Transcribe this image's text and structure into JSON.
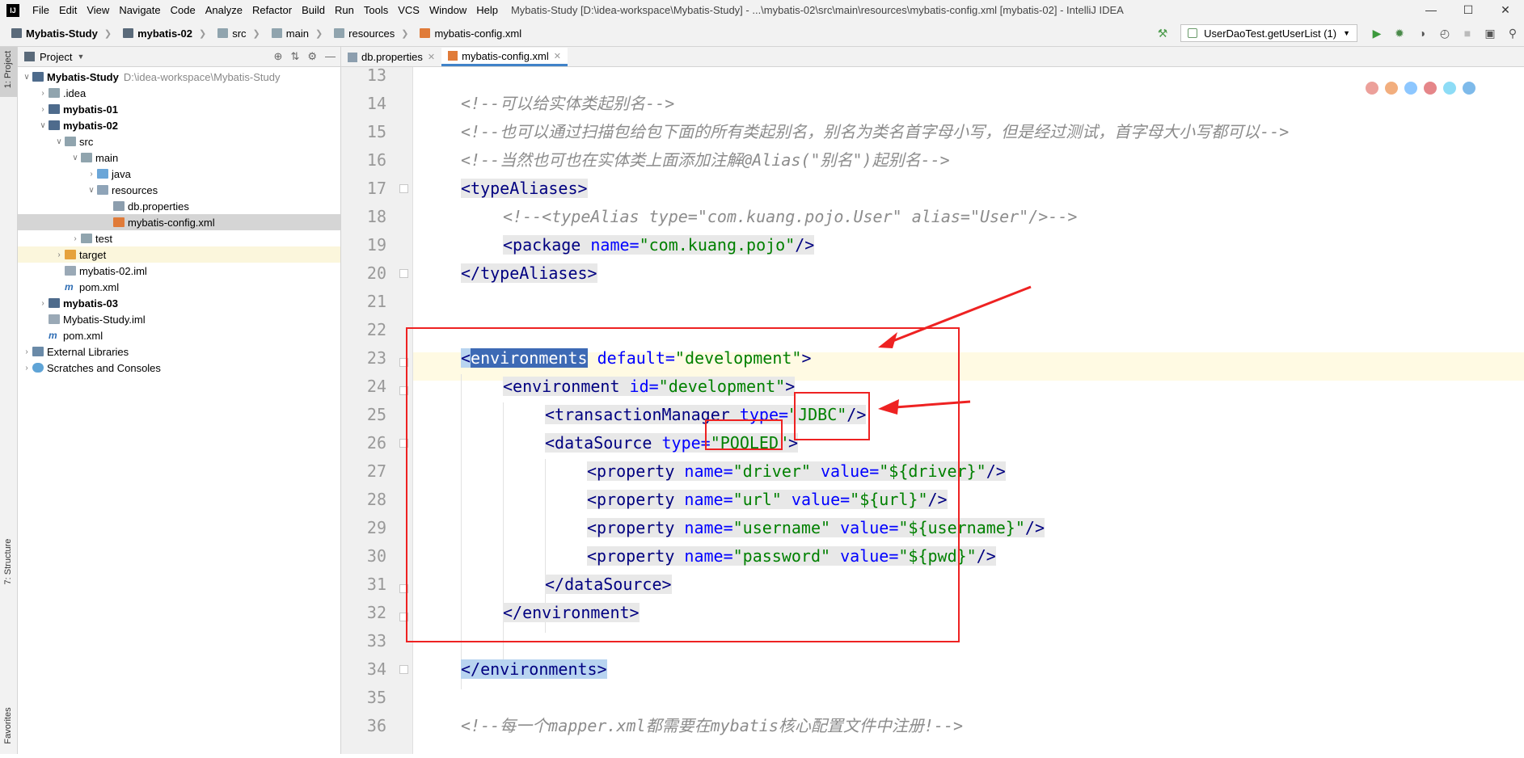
{
  "menubar": {
    "items": [
      "File",
      "Edit",
      "View",
      "Navigate",
      "Code",
      "Analyze",
      "Refactor",
      "Build",
      "Run",
      "Tools",
      "VCS",
      "Window",
      "Help"
    ],
    "window_title": "Mybatis-Study [D:\\idea-workspace\\Mybatis-Study] - ...\\mybatis-02\\src\\main\\resources\\mybatis-config.xml [mybatis-02] - IntelliJ IDEA"
  },
  "breadcrumb": [
    "Mybatis-Study",
    "mybatis-02",
    "src",
    "main",
    "resources",
    "mybatis-config.xml"
  ],
  "run_config": "UserDaoTest.getUserList (1)",
  "left_tabs": {
    "project": "1: Project",
    "structure": "7: Structure",
    "favorites": "Favorites"
  },
  "project_panel": {
    "title": "Project",
    "tree": [
      {
        "label": "Mybatis-Study",
        "path": "D:\\idea-workspace\\Mybatis-Study"
      },
      {
        "label": ".idea"
      },
      {
        "label": "mybatis-01"
      },
      {
        "label": "mybatis-02"
      },
      {
        "label": "src"
      },
      {
        "label": "main"
      },
      {
        "label": "java"
      },
      {
        "label": "resources"
      },
      {
        "label": "db.properties"
      },
      {
        "label": "mybatis-config.xml"
      },
      {
        "label": "test"
      },
      {
        "label": "target"
      },
      {
        "label": "mybatis-02.iml"
      },
      {
        "label": "pom.xml"
      },
      {
        "label": "mybatis-03"
      },
      {
        "label": "Mybatis-Study.iml"
      },
      {
        "label": "pom.xml"
      },
      {
        "label": "External Libraries"
      },
      {
        "label": "Scratches and Consoles"
      }
    ]
  },
  "editor_tabs": [
    "db.properties",
    "mybatis-config.xml"
  ],
  "code": {
    "line_numbers": [
      "13",
      "14",
      "15",
      "16",
      "17",
      "18",
      "19",
      "20",
      "21",
      "22",
      "23",
      "24",
      "25",
      "26",
      "27",
      "28",
      "29",
      "30",
      "31",
      "32",
      "33",
      "34",
      "35",
      "36"
    ],
    "l14": "<!--可以给实体类起别名-->",
    "l15": "<!--也可以通过扫描包给包下面的所有类起别名，别名为类名首字母小写，但是经过测试，首字母大小写都可以-->",
    "l16": "<!--当然也可也在实体类上面添加注解@Alias(\"别名\")起别名-->",
    "l17_tag": "<typeAliases>",
    "l18": "<!--<typeAlias type=\"com.kuang.pojo.User\" alias=\"User\"/>-->",
    "l19_tag": "<package",
    "l19_attr": "name=",
    "l19_val": "\"com.kuang.pojo\"",
    "l19_end": "/>",
    "l20_tag": "</typeAliases>",
    "l23_open": "<",
    "l23_name": "environments",
    "l23_attr": "default=",
    "l23_val": "\"development\"",
    "l23_end": ">",
    "l24_tag": "<environment",
    "l24_attr": "id=",
    "l24_val": "\"development\"",
    "l24_end": ">",
    "l25_tag": "<transactionManager",
    "l25_attr": "type=",
    "l25_val": "\"JDBC\"",
    "l25_end": "/>",
    "l26_tag": "<dataSource",
    "l26_attr": "type=",
    "l26_val": "\"POOLED\"",
    "l26_end": ">",
    "l27": {
      "tag": "<property",
      "a1": "name=",
      "v1": "\"driver\"",
      "a2": "value=",
      "v2": "\"${driver}\"",
      "end": "/>"
    },
    "l28": {
      "tag": "<property",
      "a1": "name=",
      "v1": "\"url\"",
      "a2": "value=",
      "v2": "\"${url}\"",
      "end": "/>"
    },
    "l29": {
      "tag": "<property",
      "a1": "name=",
      "v1": "\"username\"",
      "a2": "value=",
      "v2": "\"${username}\"",
      "end": "/>"
    },
    "l30": {
      "tag": "<property",
      "a1": "name=",
      "v1": "\"password\"",
      "a2": "value=",
      "v2": "\"${pwd}\"",
      "end": "/>"
    },
    "l31_tag": "</dataSource>",
    "l32_tag": "</environment>",
    "l34_open": "</",
    "l34_name": "environments",
    "l34_end": ">",
    "l36": "<!--每一个mapper.xml都需要在mybatis核心配置文件中注册!-->"
  },
  "colors": {
    "annotation": "#e22222",
    "selection": "#3d6ab5",
    "tag": "#000080",
    "attribute": "#0000ff",
    "value": "#008000",
    "comment": "#8c8c8c"
  }
}
